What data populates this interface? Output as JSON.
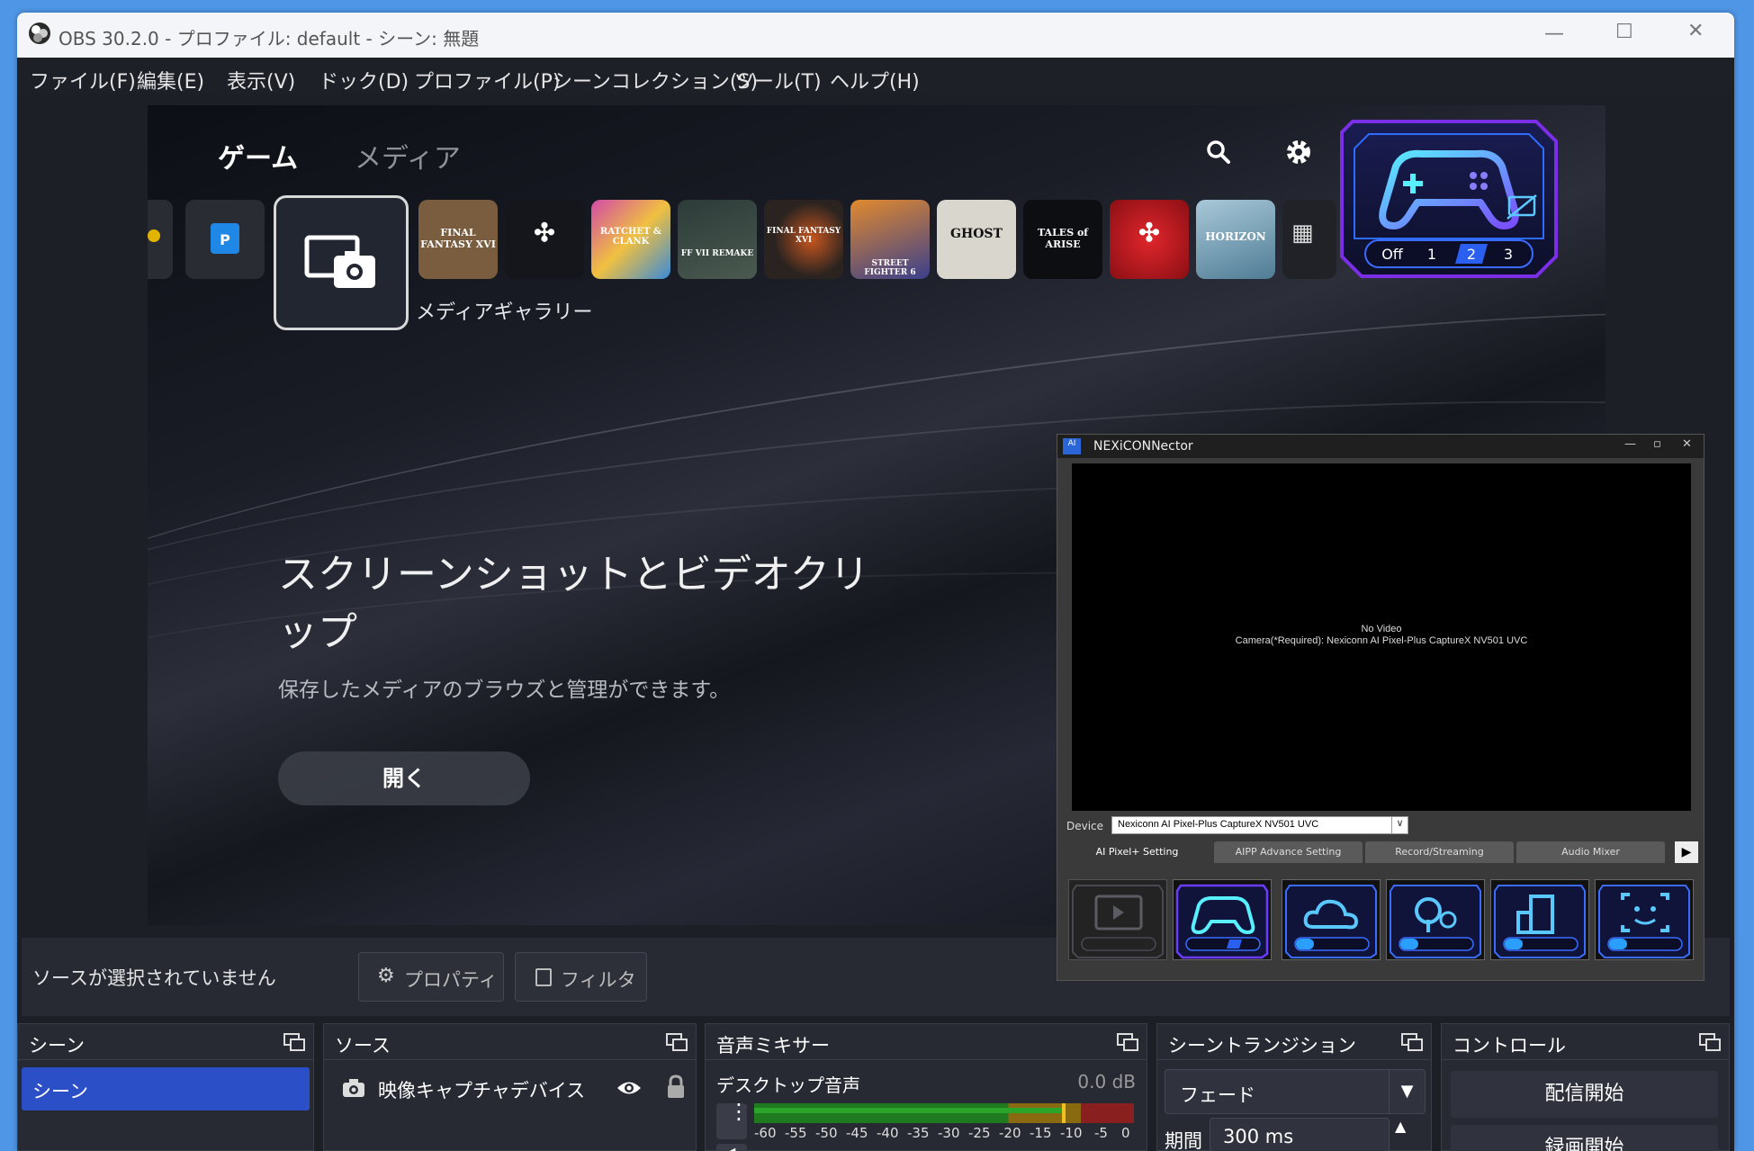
{
  "window": {
    "title": "OBS 30.2.0 - プロファイル: default - シーン: 無題"
  },
  "menu": [
    "ファイル(F)",
    "編集(E)",
    "表示(V)",
    "ドック(D)",
    "プロファイル(P)",
    "シーンコレクション(S)",
    "ツール(T)",
    "ヘルプ(H)"
  ],
  "ps5": {
    "tabs": [
      "ゲーム",
      "メディア"
    ],
    "gallery_label": "メディアギャラリー",
    "games": [
      {
        "label": "FINAL FANTASY XVI",
        "color": "#7a5d3e"
      },
      {
        "label": "SPIDER",
        "color": "#15161c"
      },
      {
        "label": "RATCHET & CLANK",
        "color": "#a23a8a"
      },
      {
        "label": "FF VII REMAKE",
        "color": "#2c3b38"
      },
      {
        "label": "FINAL FANTASY XVI",
        "color": "#2a2320"
      },
      {
        "label": "STREET FIGHTER 6",
        "color": "#3a3f8c"
      },
      {
        "label": "GHOST",
        "color": "#d9d6cd"
      },
      {
        "label": "TALES of ARISE",
        "color": "#0d0e12"
      },
      {
        "label": "SPIDER-MAN",
        "color": "#b3151a"
      },
      {
        "label": "HORIZON",
        "color": "#7ca3b8"
      }
    ],
    "headline": "スクリーンショットとビデオクリップ",
    "subtext": "保存したメディアのブラウズと管理ができます。",
    "open_button": "開く",
    "overlay_levels": [
      "Off",
      "1",
      "2",
      "3"
    ]
  },
  "nexiconnector": {
    "title": "NEXiCONNector",
    "no_video": "No Video",
    "camera": "Camera(*Required): Nexiconn AI Pixel-Plus CaptureX NV501 UVC",
    "device_label": "Device",
    "device_value": "Nexiconn AI Pixel-Plus CaptureX NV501 UVC",
    "tabs": [
      "AI Pixel+ Setting",
      "AIPP Advance Setting",
      "Record/Streaming",
      "Audio Mixer"
    ],
    "modes": [
      "video-mode",
      "game-mode",
      "cloud-mode",
      "nature-mode",
      "building-mode",
      "face-mode"
    ],
    "mode_levels": [
      "Off",
      "1",
      "2",
      "3"
    ]
  },
  "source_bar": {
    "status": "ソースが選択されていません",
    "properties": "プロパティ",
    "filters": "フィルタ"
  },
  "scenes": {
    "title": "シーン",
    "items": [
      "シーン"
    ]
  },
  "sources": {
    "title": "ソース",
    "items": [
      "映像キャプチャデバイス"
    ]
  },
  "mixer": {
    "title": "音声ミキサー",
    "channel": "デスクトップ音声",
    "level": "0.0 dB",
    "ticks": [
      "-60",
      "-55",
      "-50",
      "-45",
      "-40",
      "-35",
      "-30",
      "-25",
      "-20",
      "-15",
      "-10",
      "-5",
      "0"
    ]
  },
  "transitions": {
    "title": "シーントランジション",
    "type": "フェード",
    "duration_label": "期間",
    "duration": "300 ms"
  },
  "controls": {
    "title": "コントロール",
    "start_stream": "配信開始",
    "start_record": "録画開始"
  },
  "colors": {
    "accent": "#2b4fc7",
    "obs_bg": "#1d1f26",
    "panel": "#272a33",
    "overlay_glow": "#6a2cd8"
  }
}
